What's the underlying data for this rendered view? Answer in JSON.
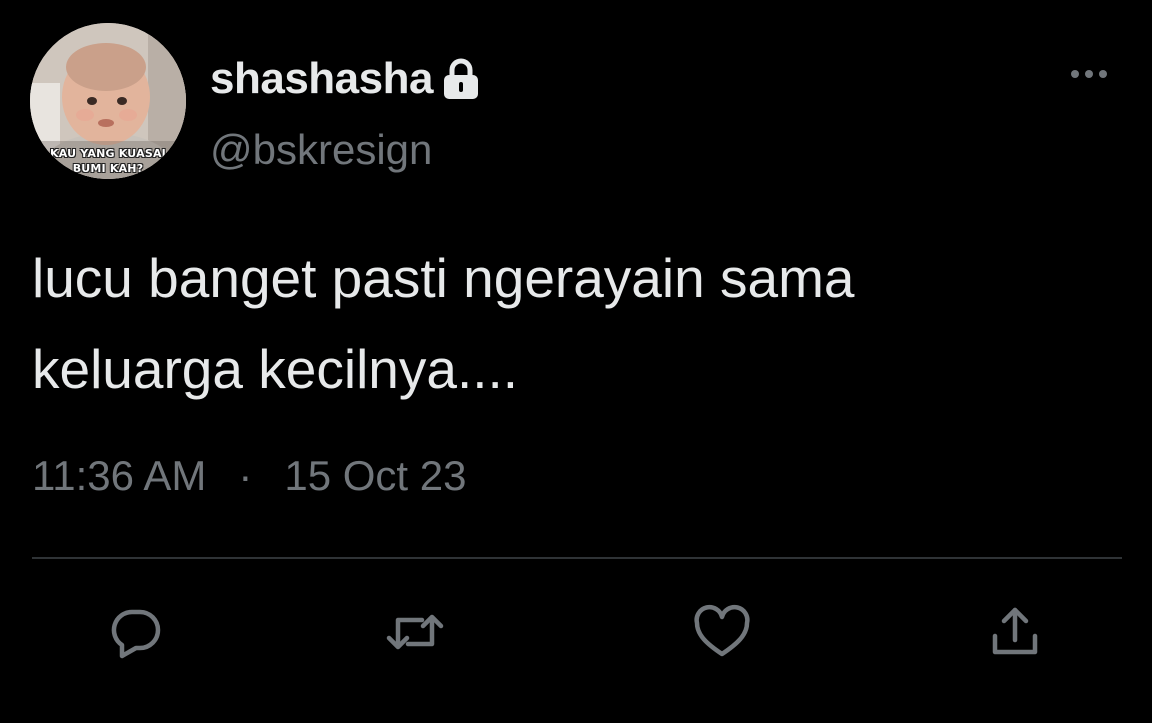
{
  "tweet": {
    "author": {
      "display_name": "shashasha",
      "handle": "@bskresign",
      "protected": true,
      "avatar_caption_line1": "KAU YANG KUASAI",
      "avatar_caption_line2": "BUMI KAH?"
    },
    "text_line1": "lucu banget pasti ngerayain sama",
    "text_line2": "keluarga kecilnya....",
    "time": "11:36 AM",
    "separator": "·",
    "date": "15 Oct 23"
  },
  "icons": {
    "more": "more-horizontal-icon",
    "reply": "reply-icon",
    "retweet": "retweet-icon",
    "like": "heart-icon",
    "share": "share-icon",
    "lock": "lock-icon"
  },
  "colors": {
    "background": "#000000",
    "primary_text": "#e7e9ea",
    "secondary_text": "#71767b",
    "divider": "#2f3336"
  }
}
